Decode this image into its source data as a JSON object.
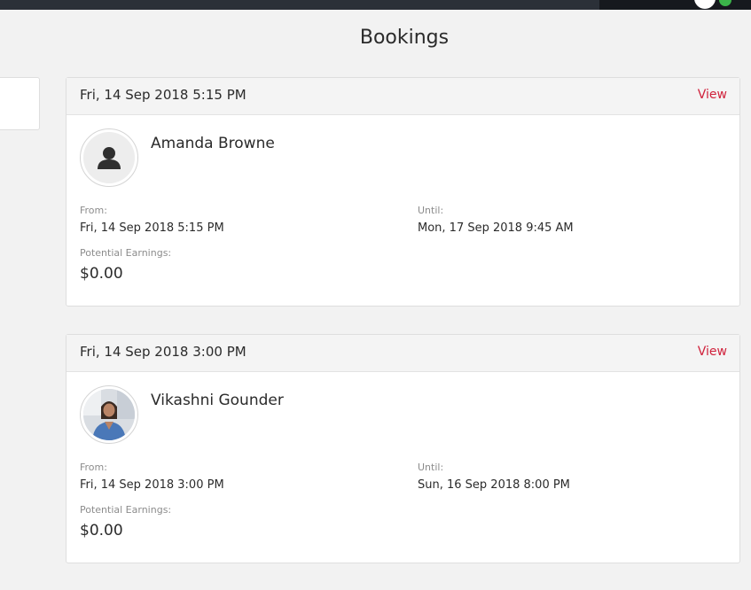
{
  "page": {
    "title": "Bookings"
  },
  "bookings": [
    {
      "date_header": "Fri, 14 Sep 2018 5:15 PM",
      "view_label": "View",
      "guest_name": "Amanda Browne",
      "avatar": "default-user-silhouette",
      "from_label": "From:",
      "from_value": "Fri, 14 Sep 2018 5:15 PM",
      "until_label": "Until:",
      "until_value": "Mon, 17 Sep 2018 9:45 AM",
      "earnings_label": "Potential Earnings:",
      "earnings_value": "$0.00"
    },
    {
      "date_header": "Fri, 14 Sep 2018 3:00 PM",
      "view_label": "View",
      "guest_name": "Vikashni Gounder",
      "avatar": "user-photo",
      "from_label": "From:",
      "from_value": "Fri, 14 Sep 2018 3:00 PM",
      "until_label": "Until:",
      "until_value": "Sun, 16 Sep 2018 8:00 PM",
      "earnings_label": "Potential Earnings:",
      "earnings_value": "$0.00"
    }
  ],
  "colors": {
    "accent": "#d0213b",
    "topbar": "#2b3038",
    "status": "#3bb54a"
  }
}
